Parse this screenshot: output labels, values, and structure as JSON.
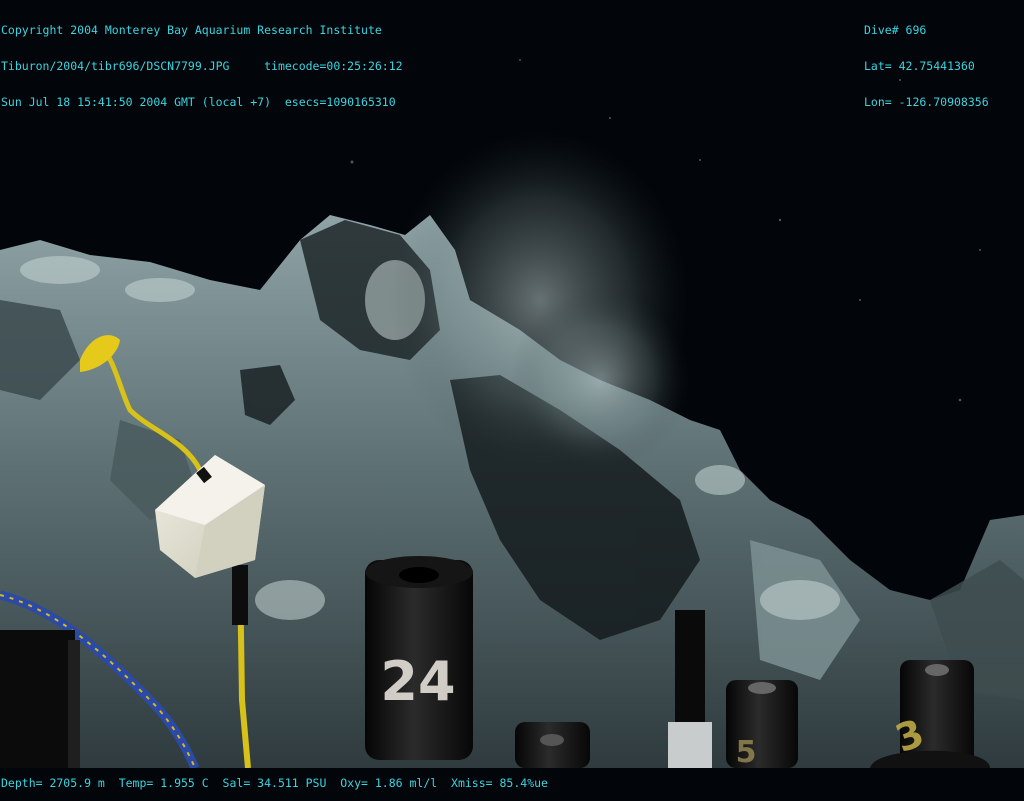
{
  "overlay": {
    "top_left": [
      "Copyright 2004 Monterey Bay Aquarium Research Institute",
      "Tiburon/2004/tibr696/DSCN7799.JPG     timecode=00:25:26:12",
      "Sun Jul 18 15:41:50 2004 GMT (local +7)  esecs=1090165310"
    ],
    "top_right": [
      "Dive# 696",
      "Lat= 42.75441360",
      "Lon= -126.70908356"
    ],
    "bottom": "Depth= 2705.9 m  Temp= 1.955 C  Sal= 34.511 PSU  Oxy= 1.86 ml/l  Xmiss= 85.4%ue"
  },
  "markers": {
    "left_tube": "24",
    "right_tube": "3",
    "mid_tube": "5"
  },
  "colors": {
    "overlay_text": "#39d6e3",
    "water": "#02060a",
    "rock": "#5f7478",
    "rope": "#d8c21a"
  }
}
